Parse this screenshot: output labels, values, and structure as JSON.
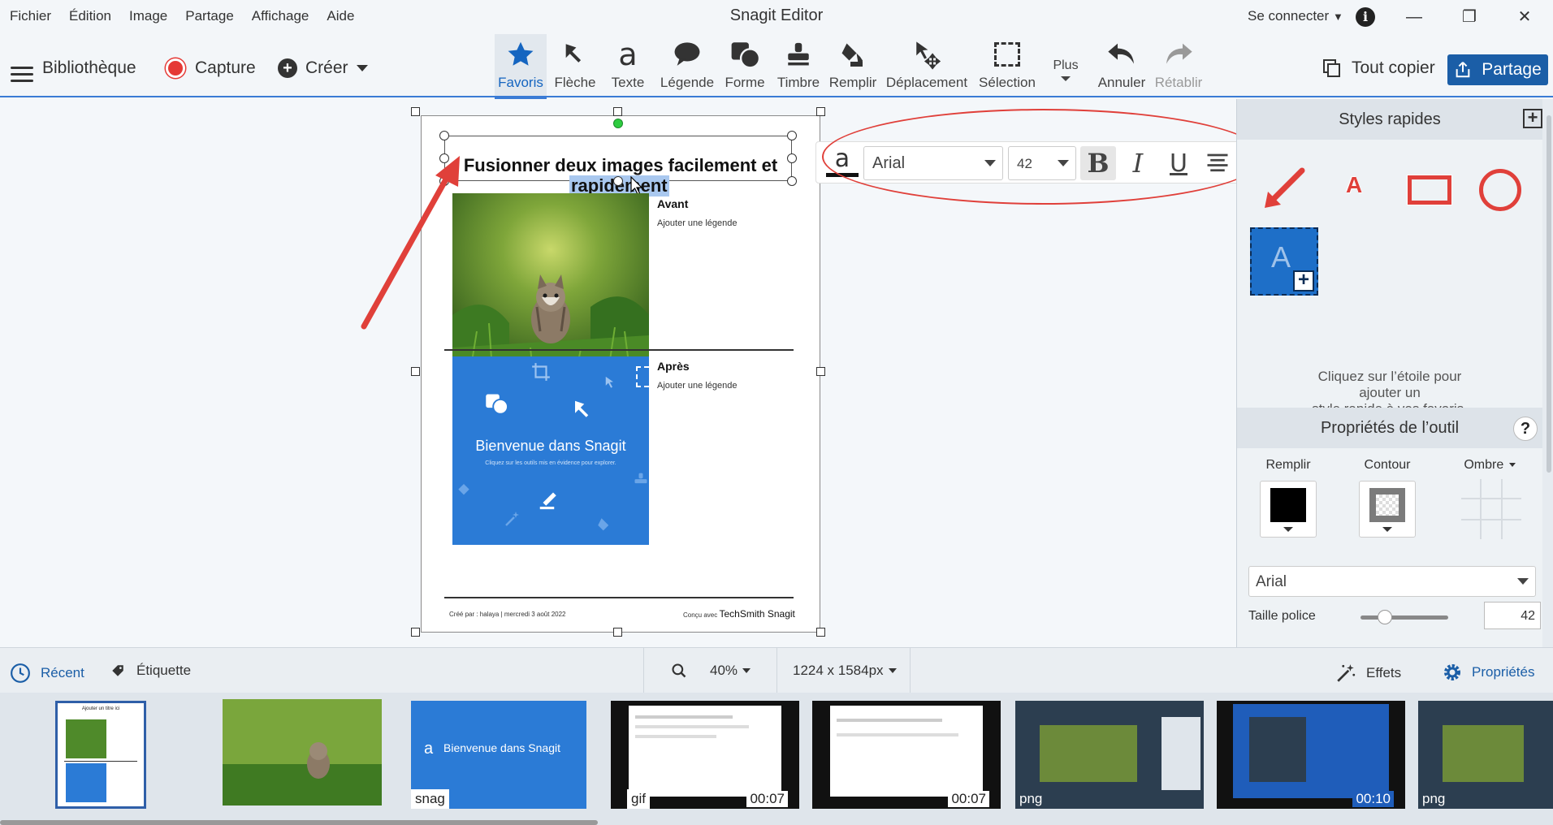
{
  "menu": [
    "Fichier",
    "Édition",
    "Image",
    "Partage",
    "Affichage",
    "Aide"
  ],
  "app_title": "Snagit Editor",
  "account": {
    "signin": "Se connecter",
    "caret": "▼"
  },
  "window": {
    "minimize": "—",
    "maximize": "❐",
    "close": "✕"
  },
  "left_tools": {
    "library": "Bibliothèque",
    "capture": "Capture",
    "create": "Créer"
  },
  "tools": [
    {
      "id": "favoris",
      "label": "Favoris"
    },
    {
      "id": "fleche",
      "label": "Flèche"
    },
    {
      "id": "texte",
      "label": "Texte"
    },
    {
      "id": "legende",
      "label": "Légende"
    },
    {
      "id": "forme",
      "label": "Forme"
    },
    {
      "id": "timbre",
      "label": "Timbre"
    },
    {
      "id": "remplir",
      "label": "Remplir"
    },
    {
      "id": "deplacement",
      "label": "Déplacement"
    },
    {
      "id": "selection",
      "label": "Sélection"
    },
    {
      "id": "plus",
      "label": "Plus"
    },
    {
      "id": "annuler",
      "label": "Annuler"
    },
    {
      "id": "retablir",
      "label": "Rétablir"
    }
  ],
  "right_tools": {
    "copy_all": "Tout copier",
    "share": "Partage"
  },
  "document": {
    "title_line1": "Fusionner deux images facilement et",
    "title_line2": "rapidement",
    "before_heading": "Avant",
    "before_caption": "Ajouter une légende",
    "after_heading": "Après",
    "after_caption": "Ajouter une légende",
    "welcome_title": "Bienvenue dans Snagit",
    "welcome_sub": "Cliquez sur les outils mis en évidence pour explorer.",
    "footer_left": "Créé par : halaya  |  mercredi 3 août 2022",
    "footer_right_prefix": "Conçu avec",
    "footer_right_brand": "TechSmith Snagit"
  },
  "format_bar": {
    "color_glyph": "a",
    "font": "Arial",
    "size": "42",
    "bold": "B",
    "italic": "I",
    "underline": "U"
  },
  "panel": {
    "quick_styles_title": "Styles rapides",
    "quick_styles_hint": [
      "Cliquez sur l’étoile pour",
      "ajouter un",
      "style rapide à vos favoris."
    ],
    "tile_letter": "A",
    "tool_props_title": "Propriétés de l’outil",
    "help": "?",
    "fill_label": "Remplir",
    "outline_label": "Contour",
    "shadow_label": "Ombre",
    "font": "Arial",
    "font_size_label": "Taille police",
    "font_size_value": "42"
  },
  "statusbar": {
    "recent": "Récent",
    "tag": "Étiquette",
    "zoom": "40%",
    "dimensions": "1224 x 1584px",
    "effects": "Effets",
    "properties": "Propriétés"
  },
  "tray": [
    {
      "label": "",
      "duration": ""
    },
    {
      "label": "",
      "duration": ""
    },
    {
      "label": "snag",
      "duration": ""
    },
    {
      "label": "gif",
      "duration": "00:07"
    },
    {
      "label": "",
      "duration": "00:07"
    },
    {
      "label": "png",
      "duration": ""
    },
    {
      "label": "",
      "duration": "00:10"
    },
    {
      "label": "png",
      "duration": ""
    }
  ],
  "tray_thumb_text": {
    "welcome": "Bienvenue dans Snagit",
    "doc_title": "Ajouter un titre ici",
    "a": "a"
  },
  "colors": {
    "accent": "#1b5ea7",
    "annotation_red": "#e0403a",
    "snagit_blue": "#2b7bd6"
  }
}
